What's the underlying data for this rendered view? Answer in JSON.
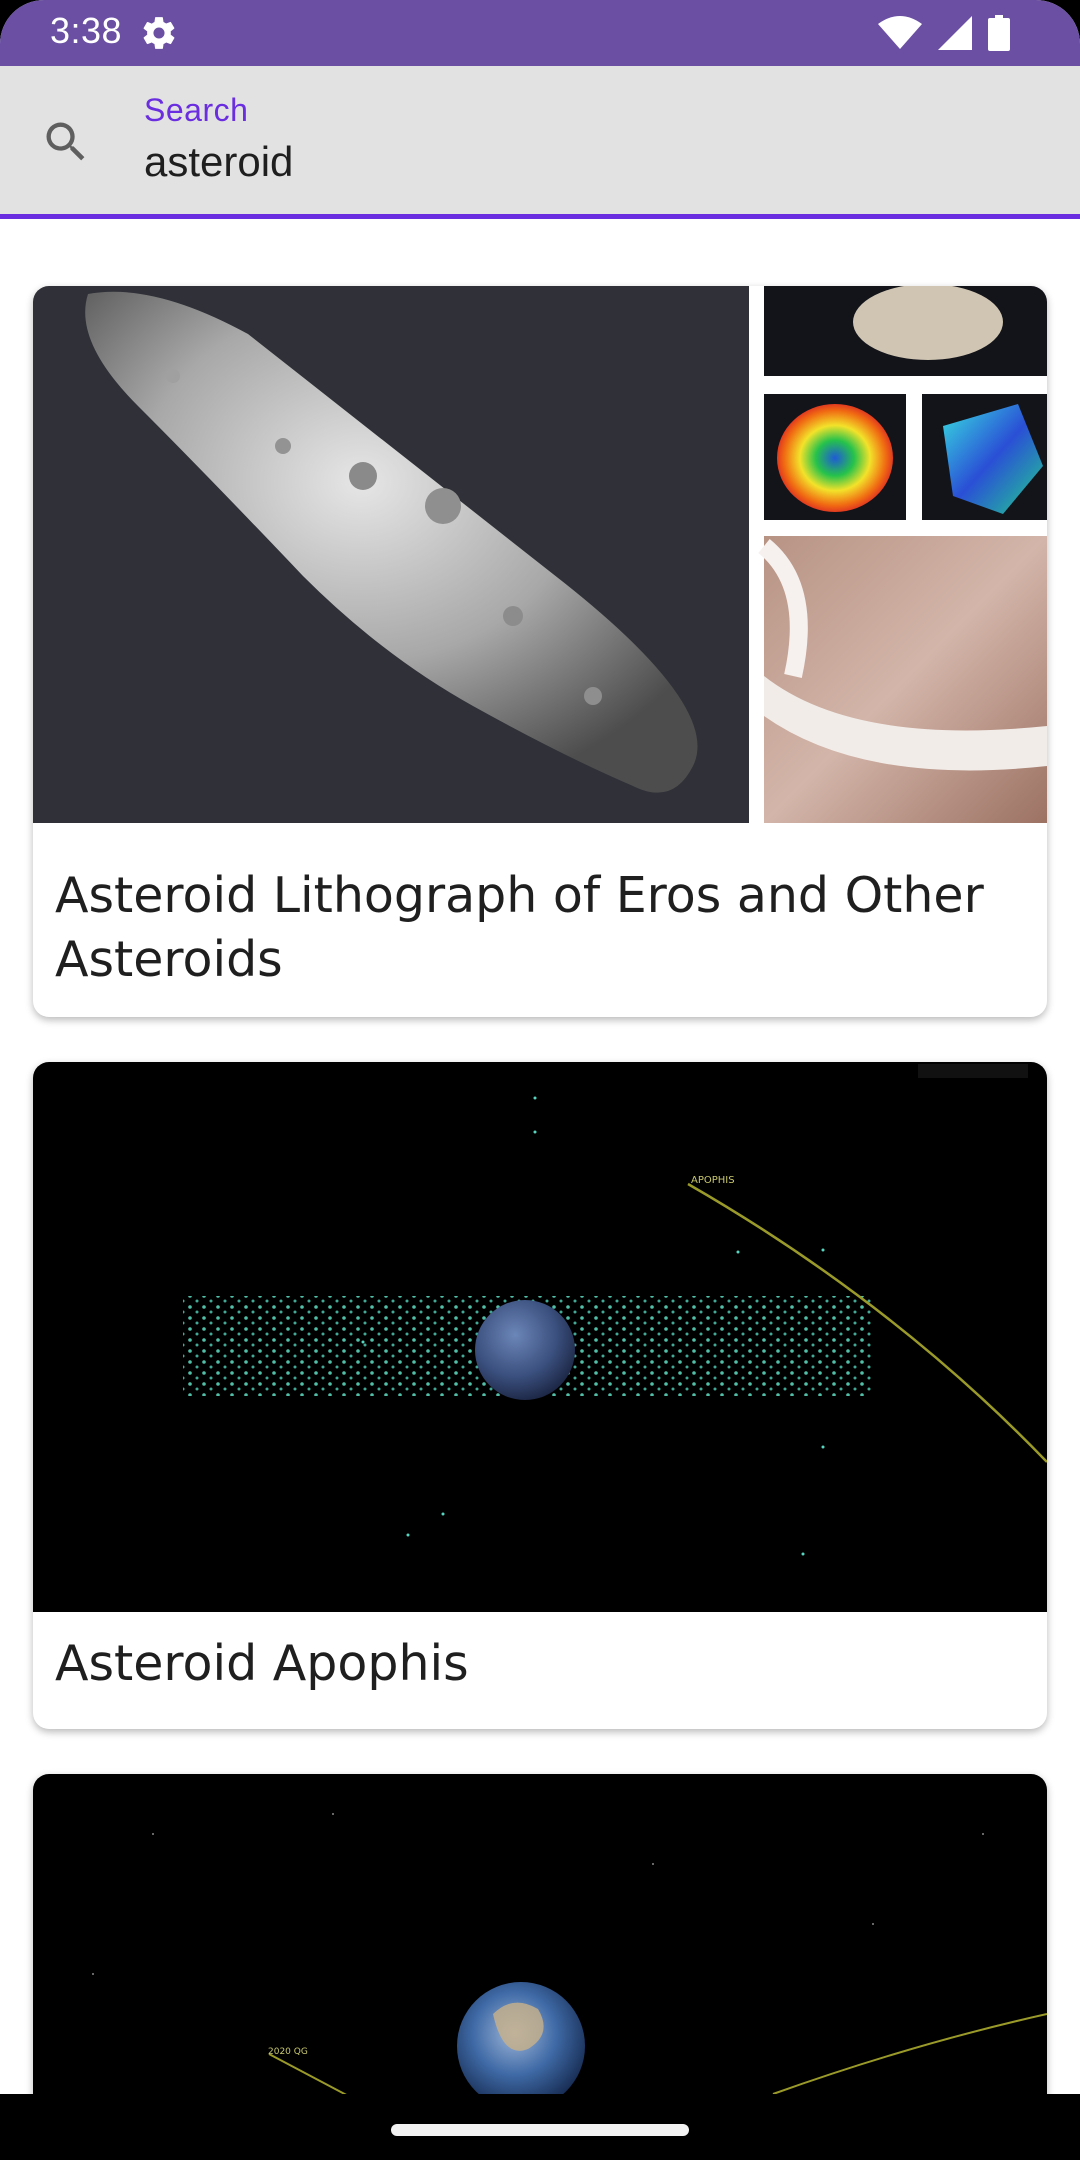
{
  "status_bar": {
    "time": "3:38",
    "icons": [
      "gear-icon",
      "wifi-icon",
      "signal-icon",
      "battery-icon"
    ],
    "color": "#6a4fa3"
  },
  "search": {
    "label": "Search",
    "value": "asteroid",
    "accent_color": "#6a2ee0"
  },
  "results": [
    {
      "title": "Asteroid Lithograph of Eros and Other Asteroids"
    },
    {
      "title": "Asteroid Apophis"
    },
    {
      "title": ""
    }
  ]
}
